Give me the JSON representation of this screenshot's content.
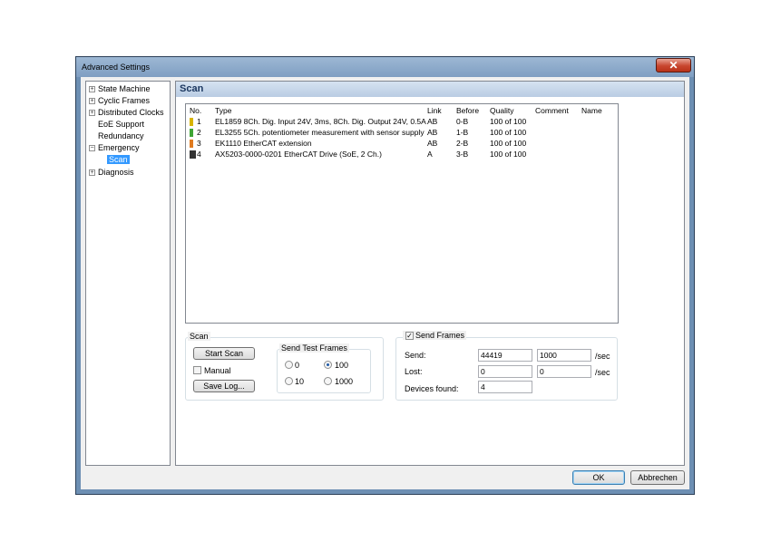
{
  "window": {
    "title": "Advanced Settings",
    "close_symbol": "✕"
  },
  "tree": {
    "items": [
      {
        "label": "State Machine",
        "expandable": true
      },
      {
        "label": "Cyclic Frames",
        "expandable": true
      },
      {
        "label": "Distributed Clocks",
        "expandable": true
      },
      {
        "label": "EoE Support",
        "expandable": false
      },
      {
        "label": "Redundancy",
        "expandable": false
      },
      {
        "label": "Emergency",
        "expandable": true
      },
      {
        "label": "Scan",
        "expandable": false,
        "selected": true
      },
      {
        "label": "Diagnosis",
        "expandable": true
      }
    ]
  },
  "panel": {
    "title": "Scan"
  },
  "table": {
    "headers": [
      "No.",
      "Type",
      "Link",
      "Before",
      "Quality",
      "Comment",
      "Name"
    ],
    "rows": [
      {
        "no": "1",
        "type": "EL1859 8Ch. Dig. Input 24V, 3ms, 8Ch. Dig. Output 24V, 0.5A",
        "link": "AB",
        "before": "0-B",
        "quality": "100 of 100",
        "comment": "",
        "name": "",
        "icon": "terminal-yellow-icon"
      },
      {
        "no": "2",
        "type": "EL3255 5Ch. potentiometer measurement with sensor supply",
        "link": "AB",
        "before": "1-B",
        "quality": "100 of 100",
        "comment": "",
        "name": "",
        "icon": "terminal-green-icon"
      },
      {
        "no": "3",
        "type": "EK1110 EtherCAT extension",
        "link": "AB",
        "before": "2-B",
        "quality": "100 of 100",
        "comment": "",
        "name": "",
        "icon": "terminal-orange-icon"
      },
      {
        "no": "4",
        "type": "AX5203-0000-0201 EtherCAT Drive (SoE, 2 Ch.)",
        "link": "A",
        "before": "3-B",
        "quality": "100 of 100",
        "comment": "",
        "name": "",
        "icon": "drive-icon"
      }
    ]
  },
  "scan_group": {
    "label": "Scan",
    "start_scan": "Start Scan",
    "manual": "Manual",
    "manual_checked": false,
    "save_log": "Save Log...",
    "send_test_frames": {
      "label": "Send Test Frames",
      "options": [
        "0",
        "100",
        "10",
        "1000"
      ],
      "selected": "100"
    }
  },
  "send_frames_group": {
    "label": "Send Frames",
    "checked": true,
    "send_label": "Send:",
    "send_value1": "44419",
    "send_value2": "1000",
    "send_unit": "/sec",
    "lost_label": "Lost:",
    "lost_value1": "0",
    "lost_value2": "0",
    "lost_unit": "/sec",
    "devices_label": "Devices found:",
    "devices_value": "4"
  },
  "buttons": {
    "ok": "OK",
    "cancel": "Abbrechen"
  }
}
